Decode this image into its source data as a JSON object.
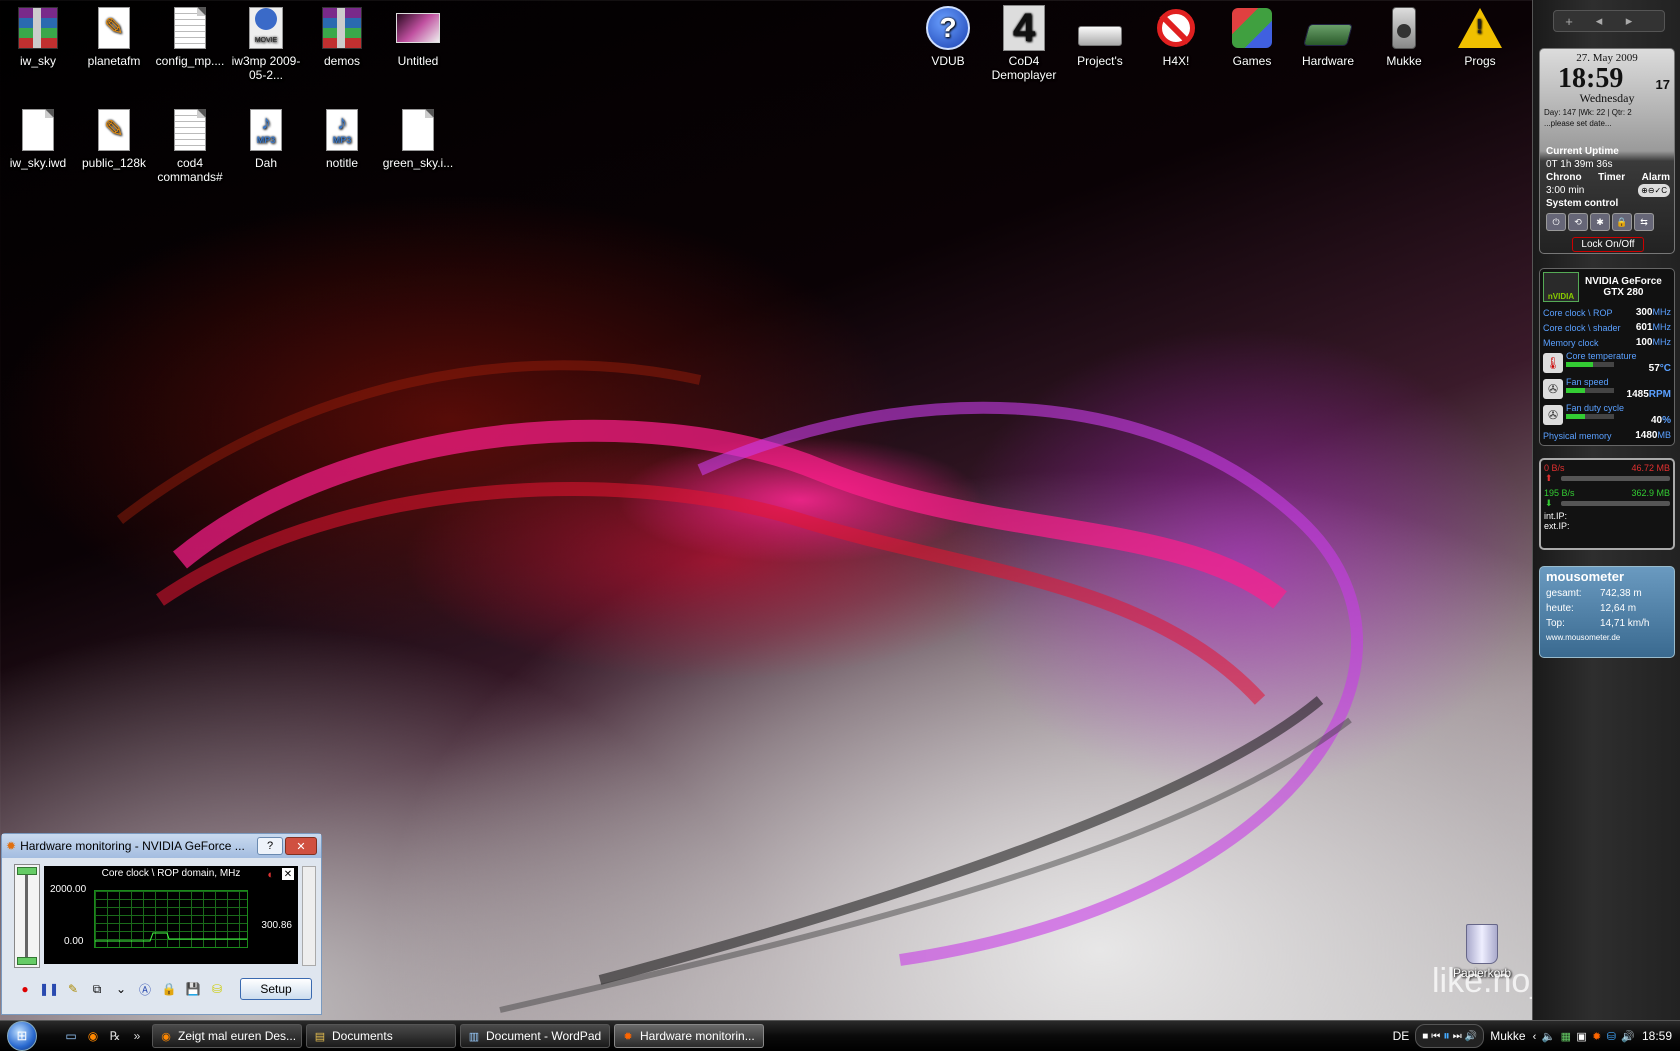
{
  "desktop_icons_left": [
    {
      "label": "iw_sky",
      "icon": "winrar-archive-icon"
    },
    {
      "label": "planetafm",
      "icon": "plugin-file-icon"
    },
    {
      "label": "config_mp....",
      "icon": "text-file-icon"
    },
    {
      "label": "iw3mp 2009-05-2...",
      "icon": "movie-file-icon"
    },
    {
      "label": "demos",
      "icon": "winrar-archive-icon"
    },
    {
      "label": "Untitled",
      "icon": "image-thumbnail-icon"
    },
    {
      "label": "iw_sky.iwd",
      "icon": "blank-file-icon"
    },
    {
      "label": "public_128k",
      "icon": "plugin-file-icon"
    },
    {
      "label": "cod4 commands#",
      "icon": "text-file-icon"
    },
    {
      "label": "Dah",
      "icon": "mp3-file-icon"
    },
    {
      "label": "notitle",
      "icon": "mp3-file-icon"
    },
    {
      "label": "green_sky.i...",
      "icon": "blank-file-icon"
    }
  ],
  "desktop_icons_right": [
    {
      "label": "VDUB",
      "icon": "help-icon"
    },
    {
      "label": "CoD4 Demoplayer",
      "icon": "cod4-icon"
    },
    {
      "label": "Project's",
      "icon": "drive-icon"
    },
    {
      "label": "H4X!",
      "icon": "no-entry-icon"
    },
    {
      "label": "Games",
      "icon": "games-icon"
    },
    {
      "label": "Hardware",
      "icon": "hardware-icon"
    },
    {
      "label": "Mukke",
      "icon": "speaker-icon"
    },
    {
      "label": "Progs",
      "icon": "warning-icon"
    }
  ],
  "recycle_bin": {
    "label": "Papierkorb"
  },
  "watermark": "like.no_other",
  "sidebar": {
    "clock": {
      "date": "27. May 2009",
      "time": "18:59",
      "seconds": "17",
      "weekday": "Wednesday",
      "info_line1": "Day: 147 |Wk: 22 | Qtr: 2",
      "info_line2": "...please set date...",
      "uptime_label": "Current Uptime",
      "uptime_value": "0T 1h 39m 36s",
      "tab_chrono": "Chrono",
      "tab_timer": "Timer",
      "tab_alarm": "Alarm",
      "timer_value": "3:00 min",
      "system_control": "System control",
      "lock_label": "Lock On/Off"
    },
    "nvidia": {
      "title_line1": "NVIDIA GeForce",
      "title_line2": "GTX 280",
      "logo_text": "nVIDIA",
      "core_rop_label": "Core clock \\ ROP",
      "core_rop_value": "300",
      "core_rop_unit": "MHz",
      "core_shader_label": "Core clock \\ shader",
      "core_shader_value": "601",
      "core_shader_unit": "MHz",
      "mem_label": "Memory clock",
      "mem_value": "100",
      "mem_unit": "MHz",
      "temp_label": "Core temperature",
      "temp_value": "57",
      "temp_unit": "°C",
      "temp_level": 0.57,
      "fan_label": "Fan speed",
      "fan_value": "1485",
      "fan_unit": "RPM",
      "fan_level": 0.4,
      "duty_label": "Fan duty cycle",
      "duty_value": "40",
      "duty_unit": "%",
      "duty_level": 0.4,
      "phys_label": "Physical memory",
      "phys_value": "1480",
      "phys_unit": "MB"
    },
    "network": {
      "up_rate": "0 B/s",
      "up_total": "46.72 MB",
      "down_rate": "195 B/s",
      "down_total": "362.9 MB",
      "int_ip_label": "int.IP:",
      "ext_ip_label": "ext.IP:"
    },
    "mousometer": {
      "title": "mousometer",
      "total_label": "gesamt:",
      "total_value": "742,38 m",
      "today_label": "heute:",
      "today_value": "12,64 m",
      "top_label": "Top:",
      "top_value": "14,71 km/h",
      "url": "www.mousometer.de"
    }
  },
  "hw_window": {
    "title": "Hardware monitoring - NVIDIA GeForce ...",
    "graph_label": "Core clock \\ ROP domain, MHz",
    "max_value": "2000.00",
    "min_value": "0.00",
    "current_value": "300.86",
    "setup_label": "Setup"
  },
  "taskbar": {
    "windows": [
      {
        "label": "Zeigt mal euren Des...",
        "icon": "firefox-icon",
        "active": false
      },
      {
        "label": "Documents",
        "icon": "folder-icon",
        "active": false
      },
      {
        "label": "Document - WordPad",
        "icon": "wordpad-icon",
        "active": false
      },
      {
        "label": "Hardware monitorin...",
        "icon": "rivatuner-icon",
        "active": true
      }
    ],
    "language": "DE",
    "player_label": "Mukke",
    "clock": "18:59"
  }
}
